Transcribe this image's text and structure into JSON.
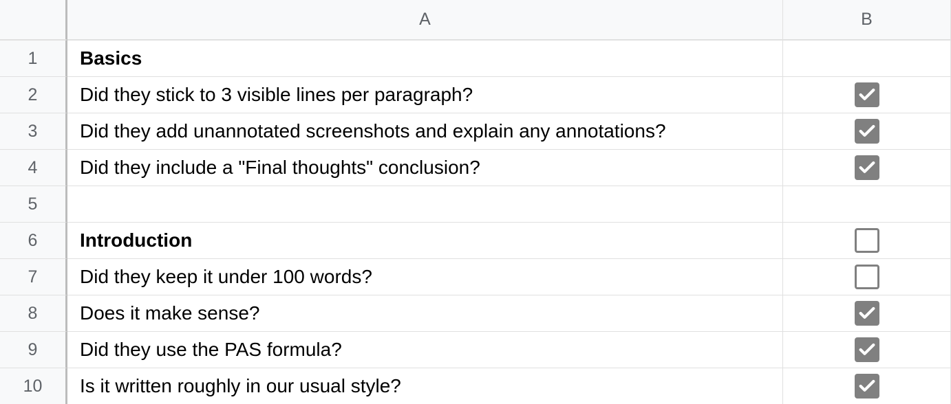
{
  "columns": [
    "A",
    "B"
  ],
  "rows": [
    {
      "num": "1",
      "a": "Basics",
      "bold": true,
      "b": null
    },
    {
      "num": "2",
      "a": "Did they stick to 3 visible lines per paragraph?",
      "bold": false,
      "b": true
    },
    {
      "num": "3",
      "a": "Did they add unannotated screenshots and explain any annotations?",
      "bold": false,
      "b": true
    },
    {
      "num": "4",
      "a": "Did they include a \"Final thoughts\" conclusion?",
      "bold": false,
      "b": true
    },
    {
      "num": "5",
      "a": "",
      "bold": false,
      "b": null
    },
    {
      "num": "6",
      "a": "Introduction",
      "bold": true,
      "b": false
    },
    {
      "num": "7",
      "a": "Did they keep it under 100 words?",
      "bold": false,
      "b": false
    },
    {
      "num": "8",
      "a": "Does it make sense?",
      "bold": false,
      "b": true
    },
    {
      "num": "9",
      "a": "Did they use the PAS formula?",
      "bold": false,
      "b": true
    },
    {
      "num": "10",
      "a": "Is it written roughly in our usual style?",
      "bold": false,
      "b": true
    }
  ]
}
